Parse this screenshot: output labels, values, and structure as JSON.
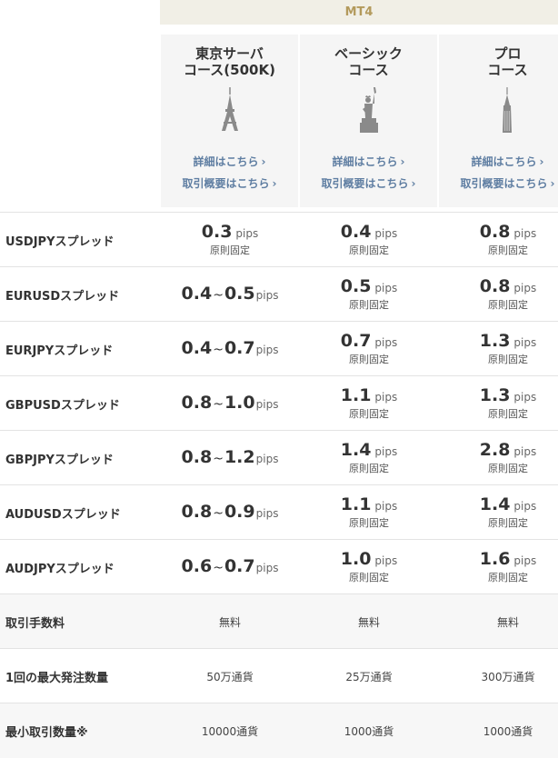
{
  "header": {
    "platform": "MT4"
  },
  "courses": [
    {
      "title_line1": "東京サーバ",
      "title_line2": "コース(500K)",
      "icon": "tower-icon",
      "link_detail": "詳細はこちら",
      "link_summary": "取引概要はこちら"
    },
    {
      "title_line1": "ベーシック",
      "title_line2": "コース",
      "icon": "statue-of-liberty-icon",
      "link_detail": "詳細はこちら",
      "link_summary": "取引概要はこちら"
    },
    {
      "title_line1": "プロ",
      "title_line2": "コース",
      "icon": "skyscraper-icon",
      "link_detail": "詳細はこちら",
      "link_summary": "取引概要はこちら"
    }
  ],
  "chevron": "›",
  "spread_unit": "pips",
  "fixed_note": "原則固定",
  "tilde": "~",
  "spread_rows": [
    {
      "label": "USDJPYスプレッド",
      "c1": {
        "value": "0.3"
      },
      "c2": {
        "value": "0.4"
      },
      "c3": {
        "value": "0.8"
      }
    },
    {
      "label": "EURUSDスプレッド",
      "c1": {
        "min": "0.4",
        "max": "0.5"
      },
      "c2": {
        "value": "0.5"
      },
      "c3": {
        "value": "0.8"
      }
    },
    {
      "label": "EURJPYスプレッド",
      "c1": {
        "min": "0.4",
        "max": "0.7"
      },
      "c2": {
        "value": "0.7"
      },
      "c3": {
        "value": "1.3"
      }
    },
    {
      "label": "GBPUSDスプレッド",
      "c1": {
        "min": "0.8",
        "max": "1.0"
      },
      "c2": {
        "value": "1.1"
      },
      "c3": {
        "value": "1.3"
      }
    },
    {
      "label": "GBPJPYスプレッド",
      "c1": {
        "min": "0.8",
        "max": "1.2"
      },
      "c2": {
        "value": "1.4"
      },
      "c3": {
        "value": "2.8"
      }
    },
    {
      "label": "AUDUSDスプレッド",
      "c1": {
        "min": "0.8",
        "max": "0.9"
      },
      "c2": {
        "value": "1.1"
      },
      "c3": {
        "value": "1.4"
      }
    },
    {
      "label": "AUDJPYスプレッド",
      "c1": {
        "min": "0.6",
        "max": "0.7"
      },
      "c2": {
        "value": "1.0"
      },
      "c3": {
        "value": "1.6"
      }
    }
  ],
  "info_rows": [
    {
      "label": "取引手数料",
      "values": [
        "無料",
        "無料",
        "無料"
      ]
    },
    {
      "label": "1回の最大発注数量",
      "values": [
        "50万通貨",
        "25万通貨",
        "300万通貨"
      ]
    },
    {
      "label": "最小取引数量※",
      "values": [
        "10000通貨",
        "1000通貨",
        "1000通貨"
      ]
    }
  ],
  "colors": {
    "accent_gold": "#b39a5c",
    "link_blue": "#5f7ea2",
    "header_bg": "#f1efe6"
  }
}
